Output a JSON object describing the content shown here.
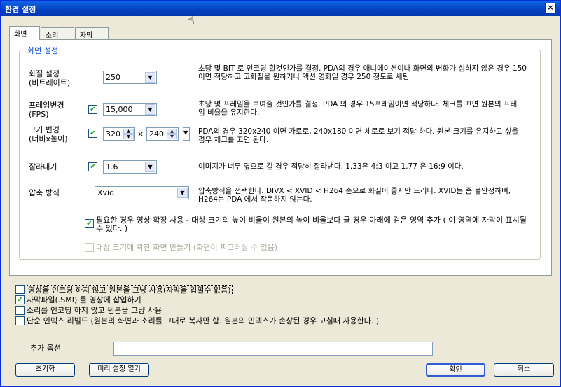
{
  "window": {
    "title": "환경 설정",
    "close_glyph": "×"
  },
  "tabs": [
    {
      "label": "화면"
    },
    {
      "label": "소리"
    },
    {
      "label": "자막"
    }
  ],
  "group": {
    "title": "화면 설정"
  },
  "quality": {
    "label1": "화질 설정",
    "label2": "(비트레이트)",
    "value": "250",
    "desc": "초당 몇 BIT 로 인코딩 할것인가를 결정. PDA의 경우 애니메이션이나 화면의 변화가 심하지 않은 경우 150 이면 적당하고 고화질을 원하거나 액션 영화일 경우 250 정도로 세팅"
  },
  "fps": {
    "label1": "프레임변경",
    "label2": "(FPS)",
    "value": "15,000",
    "desc": "초당 몇 프레임을 보여줄 것인가를 결정. PDA 의 경우 15프레임이면 적당하다. 체크를 끄면 원본의 프레임 비율을 유지한다."
  },
  "size": {
    "label1": "크기 변경",
    "label2": "(너비x높이)",
    "width": "320",
    "height": "240",
    "x": "×",
    "desc": "PDA의 경우 320x240 이면 가로로, 240x180 이면 세로로 보기 적당 하다. 원본 크기를 유지하고 싶을 경우 체크를 끄면 된다."
  },
  "crop": {
    "label": "잘라내기",
    "value": "1.6",
    "desc": "이미지가 너무 옆으로 길 경우 적당히 잘라낸다. 1.33은 4:3 이고 1.77 은 16:9 이다."
  },
  "codec": {
    "label": "압축 방식",
    "value": "Xvid",
    "desc": "압축방식을 선택한다. DIVX < XVID < H264 순으로 화질이 좋지만 느리다. XVID는 좀 불안정하며, H264는 PDA 에서 작동하지 않는다."
  },
  "letterbox": {
    "text": "필요한 경우 영상 확장 사용 - 대상 크기의 높이 비율이 원본의 높이 비율보다 클 경우 아래에 검은 영역 추가 ( 이 영역에 자막이 표시될 수 있다. )"
  },
  "fit": {
    "text": "대상 크기에 꽉찬 화면 만들기 (화면이 찌그러질 수 있음)"
  },
  "options": [
    {
      "text": "영상을 인코딩 하지 않고 원본을 그냥 사용(자막을 입힐수 없음)",
      "checked": false
    },
    {
      "text": "자막파일(.SMI) 를 영상에 삽입하기",
      "checked": true
    },
    {
      "text": "소리를 인코딩 하지 않고 원본을 그냥 사용",
      "checked": false
    },
    {
      "text": "단순 인덱스 리빌드 (원본의 화면과 소리를 그대로 복사만 함. 원본의 인덱스가 손상된 경우 고칠때 사용한다. )",
      "checked": false
    }
  ],
  "extra": {
    "label": "추가 옵션",
    "value": ""
  },
  "buttons": {
    "reset": "초기화",
    "preset": "미리 설정 열기",
    "ok": "확인",
    "cancel": "취소"
  },
  "check_glyph": "✔"
}
